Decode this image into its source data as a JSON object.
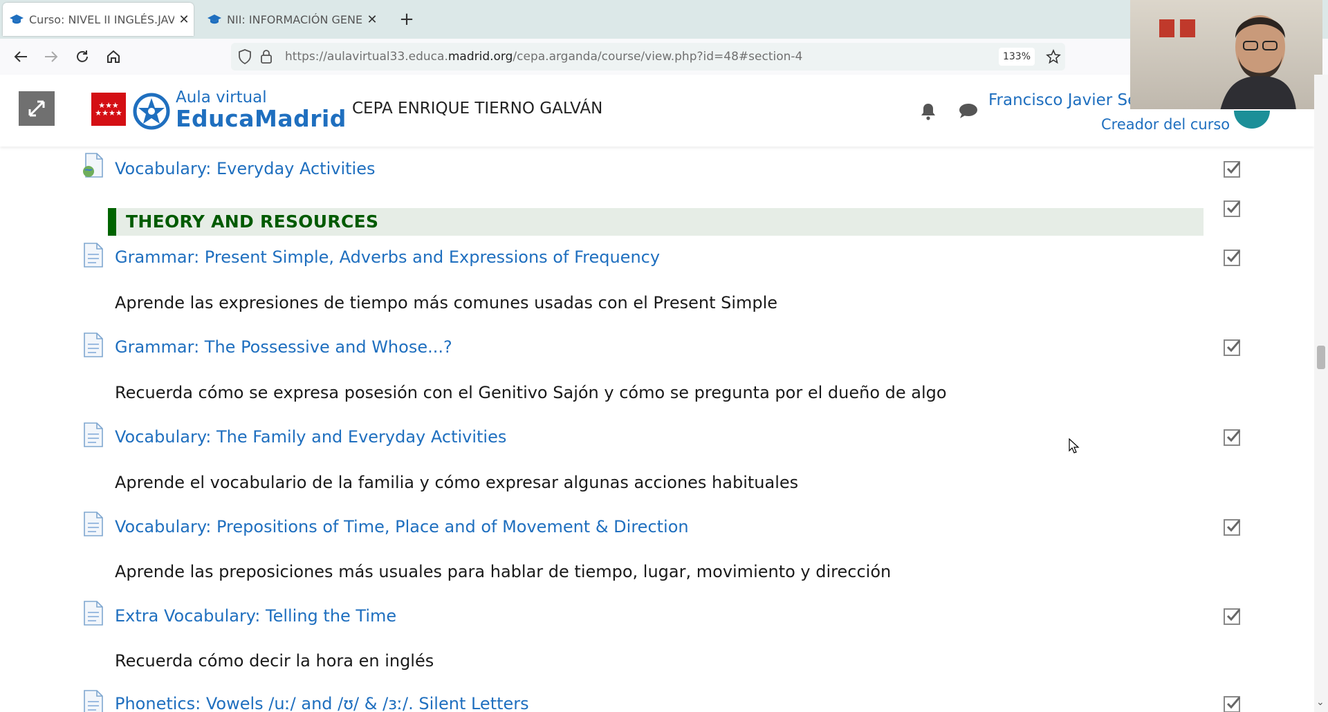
{
  "browser": {
    "tabs": [
      {
        "title": "Curso: NIVEL II INGLÉS.JAVIER",
        "active": true
      },
      {
        "title": "NII: INFORMACIÓN GENERAL S",
        "active": false
      }
    ],
    "new_tab": "+",
    "url_prefix": "https://aulavirtual33.educa.",
    "url_domain": "madrid.org",
    "url_suffix": "/cepa.arganda/course/view.php?id=48#section-4",
    "zoom": "133%"
  },
  "header": {
    "brand_small": "Aula virtual",
    "brand_big": "EducaMadrid",
    "site_name": "CEPA ENRIQUE TIERNO GALVÁN",
    "user_name": "Francisco Javier Se",
    "user_role": "Creador del curso"
  },
  "content": {
    "section_title": "THEORY AND RESOURCES",
    "items": [
      {
        "label": "Vocabulary: Everyday Activities",
        "description": ""
      },
      {
        "label": "Grammar: Present Simple, Adverbs and Expressions of Frequency",
        "description": "Aprende las expresiones de tiempo más comunes usadas con el Present Simple"
      },
      {
        "label": "Grammar: The Possessive and Whose...?",
        "description": "Recuerda cómo se expresa posesión con el Genitivo Sajón y cómo se pregunta por el dueño de algo"
      },
      {
        "label": "Vocabulary: The Family and Everyday Activities",
        "description": "Aprende el vocabulario de la familia y cómo expresar algunas acciones habituales"
      },
      {
        "label": "Vocabulary: Prepositions of Time, Place and of Movement & Direction",
        "description": "Aprende las preposiciones más usuales para hablar de tiempo, lugar, movimiento y dirección"
      },
      {
        "label": "Extra Vocabulary: Telling the Time",
        "description": "Recuerda cómo decir la hora en inglés"
      },
      {
        "label": "Phonetics: Vowels /uː/ and /ʊ/ & /ɜː/. Silent Letters",
        "description": ""
      }
    ]
  },
  "colors": {
    "link": "#1f6fbf",
    "section_accent": "#006400",
    "section_bg": "#e6ede6",
    "brand_red": "#d40f14"
  }
}
